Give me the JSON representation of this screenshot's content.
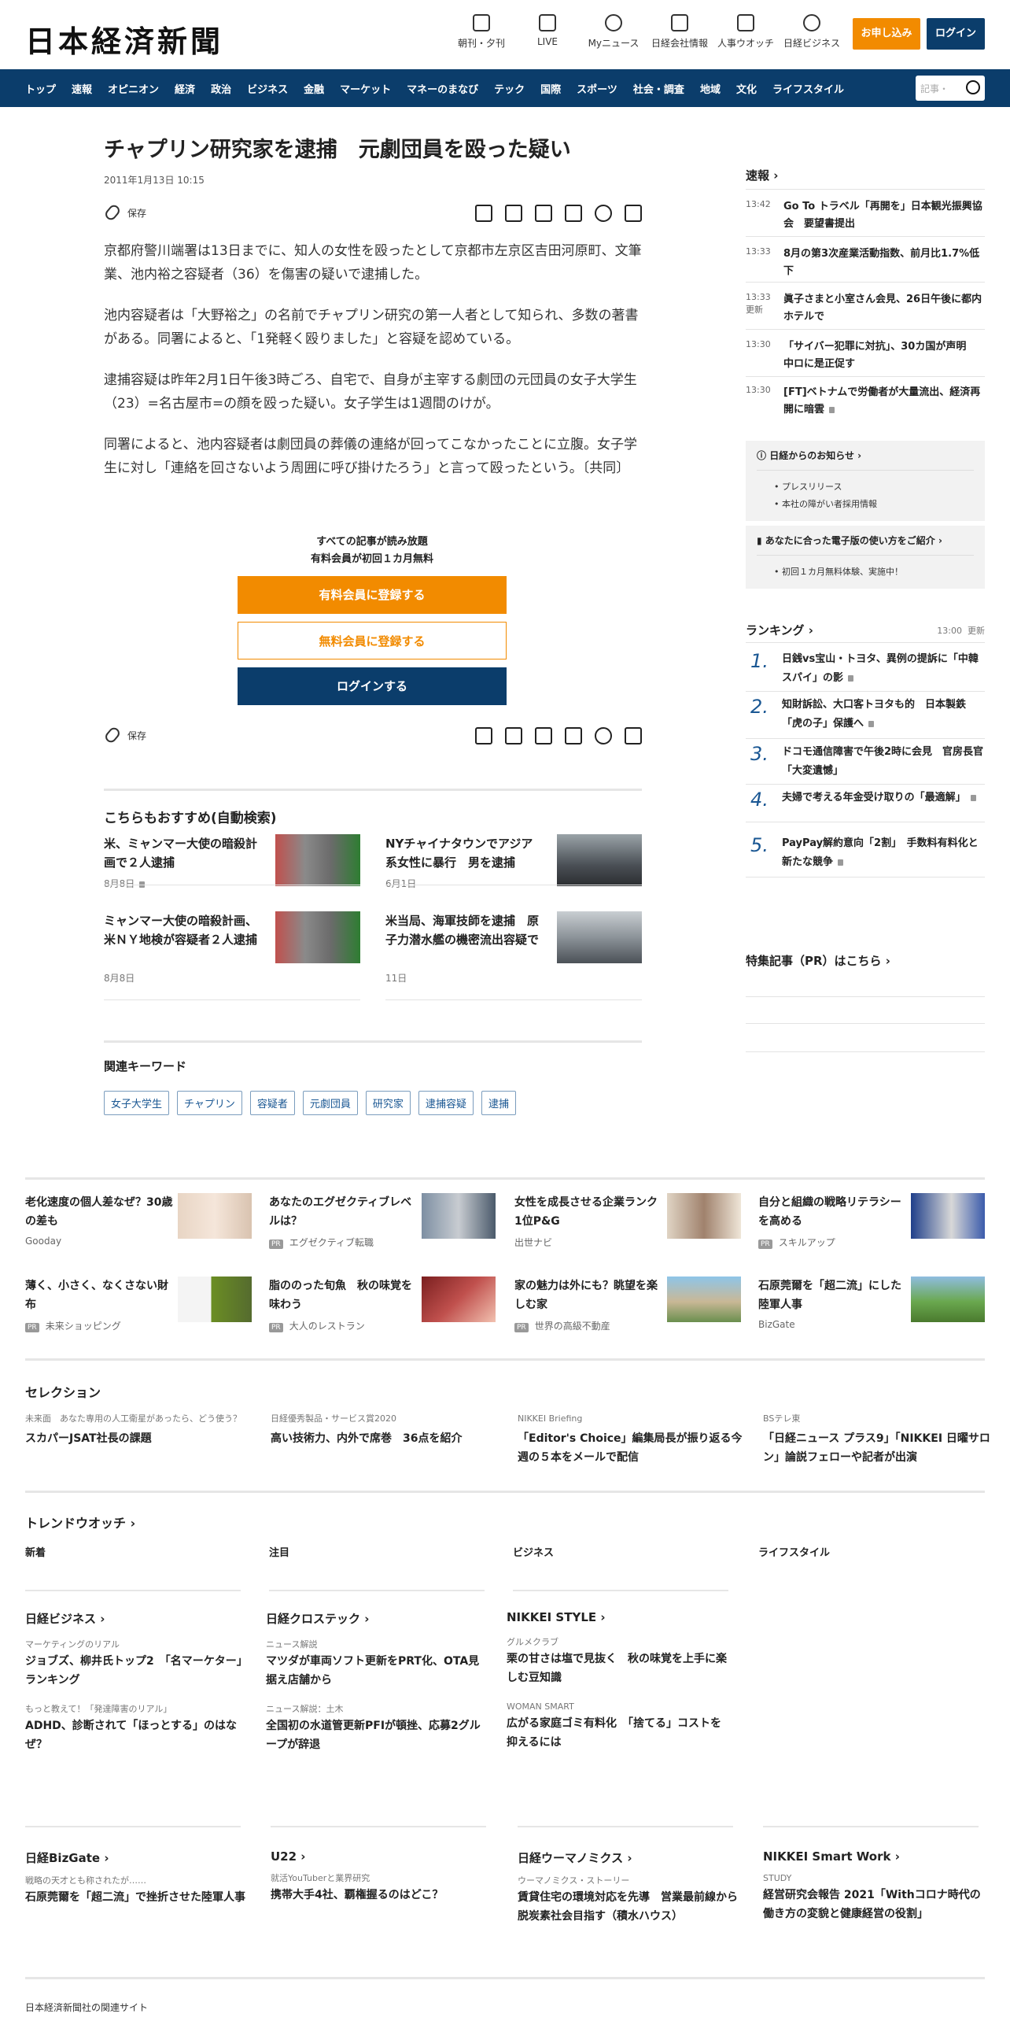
{
  "header": {
    "logo": "日本経済新聞",
    "icons": [
      {
        "label": "朝刊・夕刊",
        "icon": "newspaper-icon"
      },
      {
        "label": "LIVE",
        "icon": "video-icon"
      },
      {
        "label": "Myニュース",
        "icon": "user-icon"
      },
      {
        "label": "日経会社情報",
        "icon": "chart-icon"
      },
      {
        "label": "人事ウオッチ",
        "icon": "search-person-icon"
      },
      {
        "label": "日経ビジネス",
        "icon": "compass-icon"
      }
    ],
    "subscribe": "お申し込み",
    "login": "ログイン"
  },
  "nav": {
    "items": [
      "トップ",
      "速報",
      "オピニオン",
      "経済",
      "政治",
      "ビジネス",
      "金融",
      "マーケット",
      "マネーのまなび",
      "テック",
      "国際",
      "スポーツ",
      "社会・調査",
      "地域",
      "文化",
      "ライフスタイル"
    ],
    "search_placeholder": "記事・"
  },
  "article": {
    "title": "チャプリン研究家を逮捕　元劇団員を殴った疑い",
    "date": "2011年1月13日 10:15",
    "save_label": "保存",
    "paragraphs": [
      "京都府警川端署は13日までに、知人の女性を殴ったとして京都市左京区吉田河原町、文筆業、池内裕之容疑者（36）を傷害の疑いで逮捕した。",
      "池内容疑者は「大野裕之」の名前でチャプリン研究の第一人者として知られ、多数の著書がある。同署によると、「1発軽く殴りました」と容疑を認めている。",
      "逮捕容疑は昨年2月1日午後3時ごろ、自宅で、自身が主宰する劇団の元団員の女子大学生（23）=名古屋市=の顔を殴った疑い。女子学生は1週間のけが。",
      "同署によると、池内容疑者は劇団員の葬儀の連絡が回ってこなかったことに立腹。女子学生に対し「連絡を回さないよう周囲に呼び掛けたろう」と言って殴ったという。〔共同〕"
    ]
  },
  "paywall": {
    "line1": "すべての記事が読み放題",
    "line2": "有料会員が初回１カ月無料",
    "btn_paid": "有料会員に登録する",
    "btn_free": "無料会員に登録する",
    "btn_login": "ログインする"
  },
  "recommend": {
    "title": "こちらもおすすめ(自動検索)",
    "items": [
      {
        "title": "米、ミャンマー大使の暗殺計画で２人逮捕",
        "date": "8月8日"
      },
      {
        "title": "NYチャイナタウンでアジア系女性に暴行　男を逮捕",
        "date": "6月1日"
      },
      {
        "title": "ミャンマー大使の暗殺計画、米ＮＹ地検が容疑者２人逮捕",
        "date": "8月8日"
      },
      {
        "title": "米当局、海軍技師を逮捕　原子力潜水艦の機密流出容疑で",
        "date": "11日"
      }
    ]
  },
  "keywords": {
    "title": "関連キーワード",
    "items": [
      "女子大学生",
      "チャプリン",
      "容疑者",
      "元劇団員",
      "研究家",
      "逮捕容疑",
      "逮捕"
    ]
  },
  "sidebar": {
    "news_title": "速報",
    "news": [
      {
        "time": "13:42",
        "text": "Go To トラベル「再開を」日本観光振興協会　要望書提出",
        "updated": ""
      },
      {
        "time": "13:33",
        "text": "8月の第3次産業活動指数、前月比1.7%低下",
        "updated": ""
      },
      {
        "time": "13:33",
        "text": "眞子さまと小室さん会見、26日午後に都内ホテルで",
        "updated": "更新"
      },
      {
        "time": "13:30",
        "text": "「サイバー犯罪に対抗」、30カ国が声明　中ロに是正促す",
        "updated": ""
      },
      {
        "time": "13:30",
        "text": "[FT]ベトナムで労働者が大量流出、経済再開に暗雲",
        "updated": ""
      }
    ],
    "notice_title": "日経からのお知らせ",
    "notice_items": [
      "プレスリリース",
      "本社の障がい者採用情報"
    ],
    "guide_title": "あなたに合った電子版の使い方をご紹介",
    "guide_items": [
      "初回１カ月無料体験、実施中！"
    ],
    "ranking_title": "ランキング",
    "ranking_time": "13:00",
    "ranking_updated": "更新",
    "ranking": [
      {
        "n": "1.",
        "text": "日銭vs宝山・トヨタ、異例の提訴に「中韓スパイ」の影"
      },
      {
        "n": "2.",
        "text": "知財訴訟、大口客トヨタも的　日本製鉄「虎の子」保護へ"
      },
      {
        "n": "3.",
        "text": "ドコモ通信障害で午後2時に会見　官房長官「大変遺憾」"
      },
      {
        "n": "4.",
        "text": "夫婦で考える年金受け取りの「最適解」"
      },
      {
        "n": "5.",
        "text": "PayPay解約意向「2割」　手数料有料化と新たな競争"
      }
    ],
    "pr_title": "特集記事（PR）はこちら"
  },
  "ads": [
    {
      "title": "老化速度の個人差なぜ？30歳の差も",
      "source": "Gooday",
      "pr": false
    },
    {
      "title": "あなたのエグゼクティブレベルは？",
      "source": "エグゼクティブ転職",
      "pr": true
    },
    {
      "title": "女性を成長させる企業ランク　1位P&G",
      "source": "出世ナビ",
      "pr": false
    },
    {
      "title": "自分と組織の戦略リテラシーを高める",
      "source": "スキルアップ",
      "pr": true
    },
    {
      "title": "薄く、小さく、なくさない財布",
      "source": "未来ショッピング",
      "pr": true
    },
    {
      "title": "脂ののった旬魚　秋の味覚を味わう",
      "source": "大人のレストラン",
      "pr": true
    },
    {
      "title": "家の魅力は外にも？眺望を楽しむ家",
      "source": "世界の高級不動産",
      "pr": true
    },
    {
      "title": "石原莞爾を「超二流」にした陸軍人事",
      "source": "BizGate",
      "pr": false
    }
  ],
  "selection": {
    "title": "セレクション",
    "items": [
      {
        "kicker": "未来面　あなた専用の人工衛星があったら、どう使う？",
        "title": "スカパーJSAT社長の課題"
      },
      {
        "kicker": "日経優秀製品・サービス賞2020",
        "title": "高い技術力、内外で席巻　36点を紹介"
      },
      {
        "kicker": "NIKKEI Briefing",
        "title": "「Editor's Choice」編集局長が振り返る今週の５本をメールで配信"
      },
      {
        "kicker": "BSテレ東",
        "title": "「日経ニュース プラス9」「NIKKEI 日曜サロン」論説フェローや記者が出演"
      }
    ]
  },
  "trend": {
    "title": "トレンドウオッチ",
    "tabs": [
      "新着",
      "注目",
      "ビジネス",
      "ライフスタイル"
    ]
  },
  "media1": [
    {
      "title": "日経ビジネス",
      "items": [
        {
          "kicker": "マーケティングのリアル",
          "title": "ジョブズ、柳井氏トップ2　「名マーケター」ランキング"
        },
        {
          "kicker": "もっと教えて！「発達障害のリアル」",
          "title": "ADHD、診断されて「ほっとする」のはなぜ？"
        }
      ]
    },
    {
      "title": "日経クロステック",
      "items": [
        {
          "kicker": "ニュース解説",
          "title": "マツダが車両ソフト更新をPRT化、OTA見据え店舗から"
        },
        {
          "kicker": "ニュース解説：土木",
          "title": "全国初の水道管更新PFIが頓挫、応募2グループが辞退"
        }
      ]
    },
    {
      "title": "NIKKEI STYLE",
      "items": [
        {
          "kicker": "グルメクラブ",
          "title": "栗の甘さは塩で見抜く　秋の味覚を上手に楽しむ豆知識"
        },
        {
          "kicker": "WOMAN SMART",
          "title": "広がる家庭ゴミ有料化　「捨てる」コストを抑えるには"
        }
      ]
    }
  ],
  "media2": [
    {
      "title": "日経BizGate",
      "kicker": "戦略の天才とも称されたが……",
      "text": "石原莞爾を「超二流」で挫折させた陸軍人事"
    },
    {
      "title": "U22",
      "kicker": "就活YouTuberと業界研究",
      "text": "携帯大手4社、覇権握るのはどこ？"
    },
    {
      "title": "日経ウーマノミクス",
      "kicker": "ウーマノミクス・ストーリー",
      "text": "賃貸住宅の環境対応を先導　営業最前線から脱炭素社会目指す（積水ハウス）"
    },
    {
      "title": "NIKKEI Smart Work",
      "kicker": "STUDY",
      "text": "経営研究会報告 2021「Withコロナ時代の働き方の変貌と健康経営の役割」"
    }
  ],
  "footer": "日本経済新聞社の関連サイト",
  "colors": {
    "brand": "#0b3d6b",
    "accent": "#f28b00"
  }
}
